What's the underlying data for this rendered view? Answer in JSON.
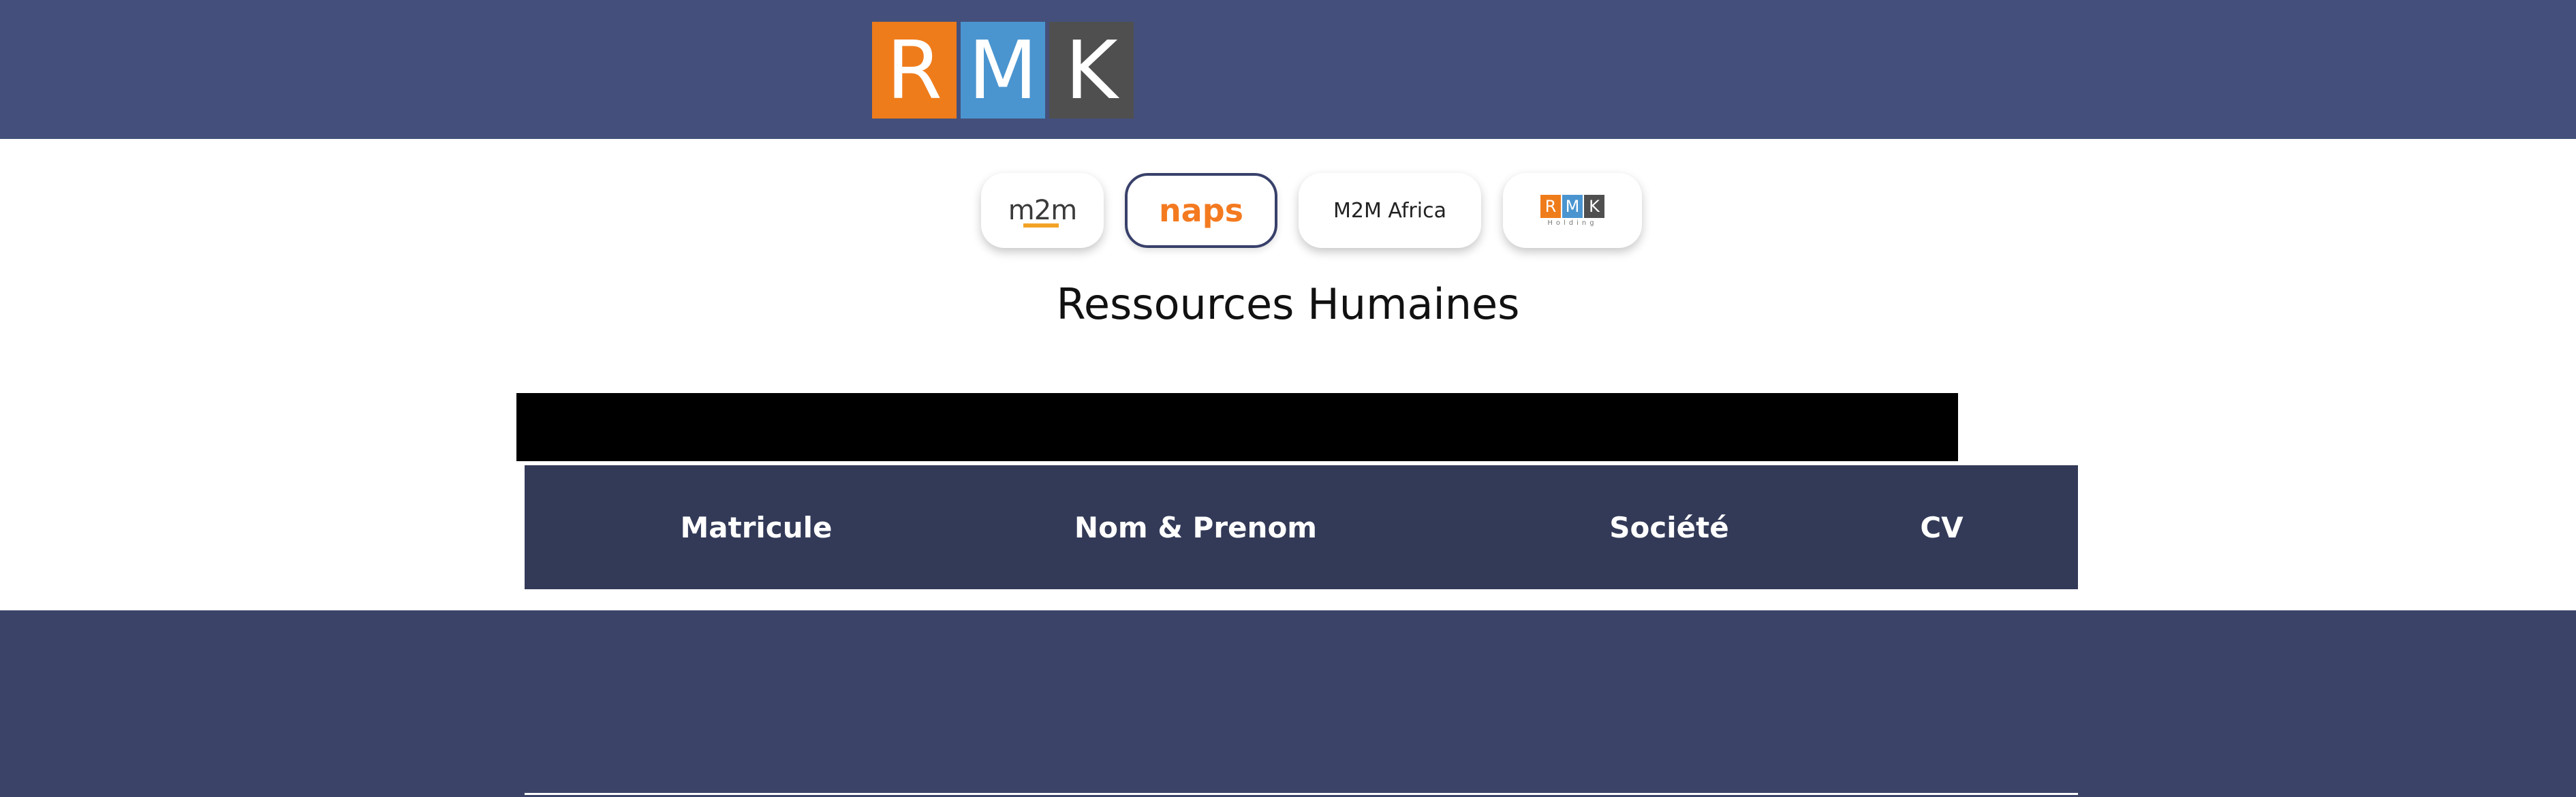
{
  "header": {
    "logo": {
      "letters": [
        "R",
        "M",
        "K"
      ],
      "colors": [
        "#ef7c1b",
        "#4a95d0",
        "#4f4f4f"
      ]
    },
    "background": "#44507b"
  },
  "companies": [
    {
      "id": "m2m",
      "logo_text": "m2m"
    },
    {
      "id": "naps",
      "logo_text": "naps",
      "active": true
    },
    {
      "id": "m2m-africa",
      "label": "M2M Africa"
    },
    {
      "id": "rmk-holding",
      "logo_letters": [
        "R",
        "M",
        "K"
      ],
      "logo_sub": "Holding"
    }
  ],
  "page": {
    "title": "Ressources Humaines"
  },
  "table": {
    "columns": [
      "Matricule",
      "Nom & Prenom",
      "Société",
      "CV"
    ],
    "header_color": "#333a58"
  },
  "footer": {
    "background": "#3b4468"
  }
}
